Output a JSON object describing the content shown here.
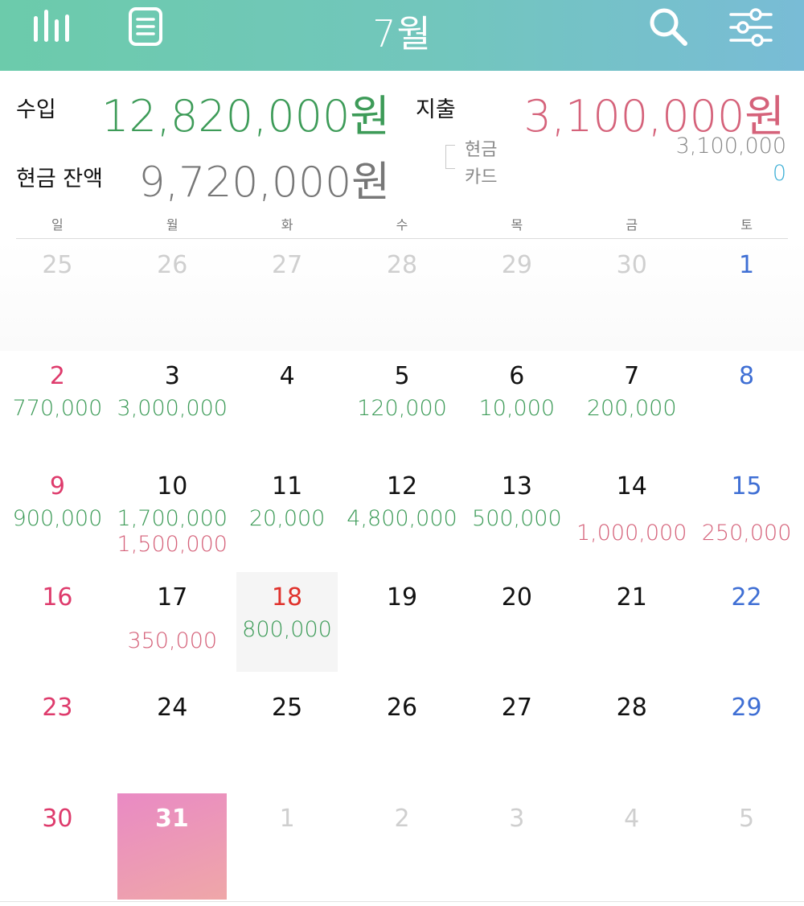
{
  "header": {
    "month_title": "7월",
    "icons": [
      "bar-chart-icon",
      "document-icon",
      "search-icon",
      "filter-sliders-icon"
    ]
  },
  "summary": {
    "income_label": "수입",
    "income_amount": "12,820,000원",
    "expense_label": "지출",
    "expense_amount": "3,100,000원",
    "cash_balance_label": "현금 잔액",
    "cash_balance_amount": "9,720,000원",
    "cash_sub_label": "현금",
    "cash_sub_amount": "3,100,000",
    "card_sub_label": "카드",
    "card_sub_amount": "0"
  },
  "weekdays": [
    "일",
    "월",
    "화",
    "수",
    "목",
    "금",
    "토"
  ],
  "colors": {
    "income": "#3d9b58",
    "expense": "#d5627a",
    "sunday": "#de3b6c",
    "saturday": "#3f6fd4",
    "today": "#e0322c",
    "card": "#3fb0d6"
  },
  "weeks": [
    [
      {
        "day": "25",
        "type": "dim"
      },
      {
        "day": "26",
        "type": "dim"
      },
      {
        "day": "27",
        "type": "dim"
      },
      {
        "day": "28",
        "type": "dim"
      },
      {
        "day": "29",
        "type": "dim"
      },
      {
        "day": "30",
        "type": "dim"
      },
      {
        "day": "1",
        "type": "sat"
      }
    ],
    [
      {
        "day": "2",
        "type": "sun",
        "income": "770,000"
      },
      {
        "day": "3",
        "type": "normal",
        "income": "3,000,000"
      },
      {
        "day": "4",
        "type": "normal"
      },
      {
        "day": "5",
        "type": "normal",
        "income": "120,000"
      },
      {
        "day": "6",
        "type": "normal",
        "income": "10,000"
      },
      {
        "day": "7",
        "type": "normal",
        "income": "200,000"
      },
      {
        "day": "8",
        "type": "sat"
      }
    ],
    [
      {
        "day": "9",
        "type": "sun",
        "income": "900,000"
      },
      {
        "day": "10",
        "type": "normal",
        "income": "1,700,000",
        "expense": "1,500,000"
      },
      {
        "day": "11",
        "type": "normal",
        "income": "20,000"
      },
      {
        "day": "12",
        "type": "normal",
        "income": "4,800,000"
      },
      {
        "day": "13",
        "type": "normal",
        "income": "500,000"
      },
      {
        "day": "14",
        "type": "normal",
        "expense_mid": "1,000,000"
      },
      {
        "day": "15",
        "type": "sat",
        "expense_mid": "250,000"
      }
    ],
    [
      {
        "day": "16",
        "type": "sun"
      },
      {
        "day": "17",
        "type": "normal",
        "expense": "350,000"
      },
      {
        "day": "18",
        "type": "today",
        "income": "800,000"
      },
      {
        "day": "19",
        "type": "normal"
      },
      {
        "day": "20",
        "type": "normal"
      },
      {
        "day": "21",
        "type": "normal"
      },
      {
        "day": "22",
        "type": "sat"
      }
    ],
    [
      {
        "day": "23",
        "type": "sun"
      },
      {
        "day": "24",
        "type": "normal"
      },
      {
        "day": "25",
        "type": "normal"
      },
      {
        "day": "26",
        "type": "normal"
      },
      {
        "day": "27",
        "type": "normal"
      },
      {
        "day": "28",
        "type": "normal"
      },
      {
        "day": "29",
        "type": "sat"
      }
    ],
    [
      {
        "day": "30",
        "type": "sun"
      },
      {
        "day": "31",
        "type": "selected"
      },
      {
        "day": "1",
        "type": "dim"
      },
      {
        "day": "2",
        "type": "dim"
      },
      {
        "day": "3",
        "type": "dim"
      },
      {
        "day": "4",
        "type": "dim"
      },
      {
        "day": "5",
        "type": "dim"
      }
    ]
  ]
}
